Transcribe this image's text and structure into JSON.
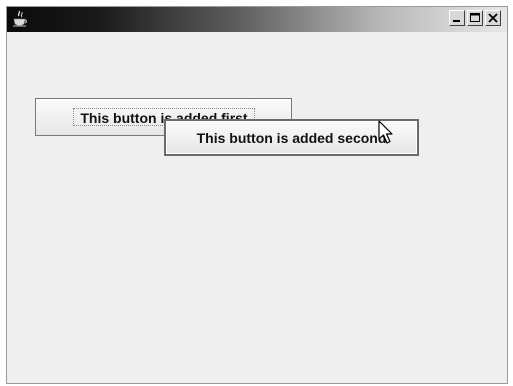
{
  "window": {
    "title": "",
    "controls": {
      "minimize_icon": "minimize-icon",
      "maximize_icon": "maximize-icon",
      "close_icon": "close-icon"
    }
  },
  "buttons": {
    "first_label": "This button is added first",
    "second_label": "This button is added second"
  },
  "colors": {
    "window_background": "#efefef",
    "titlebar_dark": "#0a0a0a",
    "titlebar_light": "#e8e8e8"
  }
}
